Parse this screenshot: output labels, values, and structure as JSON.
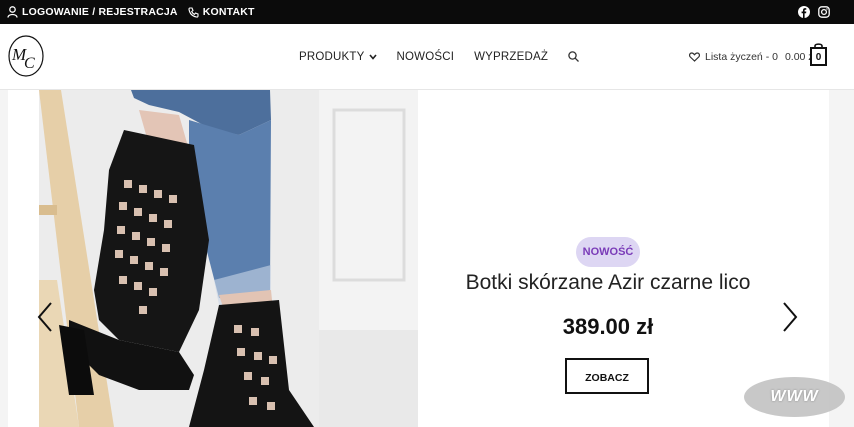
{
  "topbar": {
    "login_label": "LOGOWANIE / REJESTRACJA",
    "contact_label": "KONTAKT",
    "social": [
      "facebook-icon",
      "instagram-icon"
    ]
  },
  "header": {
    "logo_text": "MC",
    "nav": {
      "products": "PRODUKTY",
      "news": "NOWOŚCI",
      "sale": "WYPRZEDAŻ"
    },
    "wishlist_label": "Lista życzeń - 0",
    "cart_total": "0.00 zł",
    "cart_count": "0"
  },
  "slide": {
    "badge": "NOWOŚĆ",
    "title": "Botki skórzane Azir czarne lico",
    "price": "389.00 zł",
    "button_label": "ZOBACZ"
  },
  "watermark": "WWW",
  "colors": {
    "topbar_bg": "#0b0b0b",
    "badge_bg": "#ddd6f3",
    "badge_text": "#7a3bb8"
  }
}
